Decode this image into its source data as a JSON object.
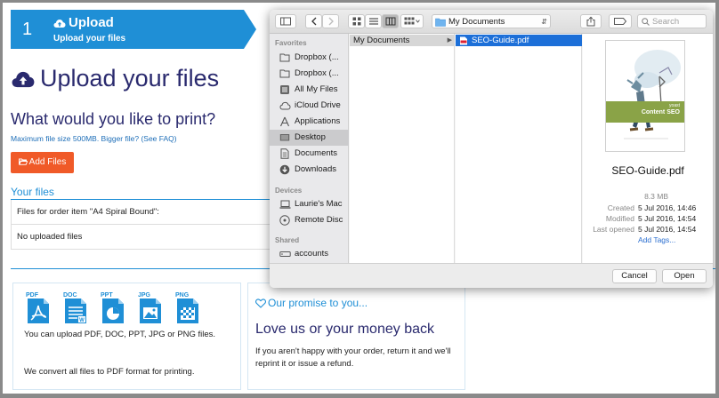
{
  "step": {
    "number": "1",
    "title": "Upload",
    "subtitle": "Upload your files"
  },
  "page": {
    "heading": "Upload your files",
    "question": "What would you like to print?",
    "max_size_note": "Maximum file size 500MB. Bigger file? (See FAQ)",
    "add_files_label": "Add Files",
    "your_files_label": "Your files",
    "files_table": {
      "header": "Files for order item \"A4 Spiral Bound\":",
      "empty_text": "No uploaded files"
    }
  },
  "formats_box": {
    "icons": [
      {
        "label": "PDF",
        "icon": "pdf-file-icon"
      },
      {
        "label": "DOC",
        "icon": "doc-file-icon"
      },
      {
        "label": "PPT",
        "icon": "ppt-file-icon"
      },
      {
        "label": "JPG",
        "icon": "jpg-file-icon"
      },
      {
        "label": "PNG",
        "icon": "png-file-icon"
      }
    ],
    "text1": "You can upload PDF, DOC, PPT, JPG or PNG files.",
    "text2": "We convert all files to PDF format for printing."
  },
  "promise_box": {
    "title": "Our promise to you...",
    "heading": "Love us or your money back",
    "text": "If you aren't happy with your order, return it and we'll reprint it or issue a refund."
  },
  "dialog": {
    "location": "My Documents",
    "search_placeholder": "Search",
    "sidebar": {
      "favorites_label": "Favorites",
      "favorites": [
        {
          "label": "Dropbox (...",
          "icon": "dropbox-icon"
        },
        {
          "label": "Dropbox (...",
          "icon": "dropbox-icon"
        },
        {
          "label": "All My Files",
          "icon": "all-files-icon"
        },
        {
          "label": "iCloud Drive",
          "icon": "cloud-icon"
        },
        {
          "label": "Applications",
          "icon": "applications-icon"
        },
        {
          "label": "Desktop",
          "icon": "desktop-icon",
          "active": true
        },
        {
          "label": "Documents",
          "icon": "documents-icon"
        },
        {
          "label": "Downloads",
          "icon": "downloads-icon"
        }
      ],
      "devices_label": "Devices",
      "devices": [
        {
          "label": "Laurie's Mac",
          "icon": "laptop-icon"
        },
        {
          "label": "Remote Disc",
          "icon": "disc-icon"
        }
      ],
      "shared_label": "Shared",
      "shared": [
        {
          "label": "accounts",
          "icon": "server-icon"
        }
      ]
    },
    "column1_item": "My Documents",
    "column2_item": "SEO-Guide.pdf",
    "preview": {
      "book_title": "Content SEO",
      "book_brand": "yoast",
      "filename": "SEO-Guide.pdf",
      "size": "8.3 MB",
      "meta": [
        {
          "key": "Created",
          "value": "5 Jul 2016, 14:46"
        },
        {
          "key": "Modified",
          "value": "5 Jul 2016, 14:54"
        },
        {
          "key": "Last opened",
          "value": "5 Jul 2016, 14:54"
        }
      ],
      "add_tags": "Add Tags..."
    },
    "cancel_label": "Cancel",
    "open_label": "Open"
  },
  "colors": {
    "accent_blue": "#1f8fd6",
    "navy": "#2a2a6e",
    "orange": "#f05a28",
    "selection": "#1c6fd8"
  }
}
